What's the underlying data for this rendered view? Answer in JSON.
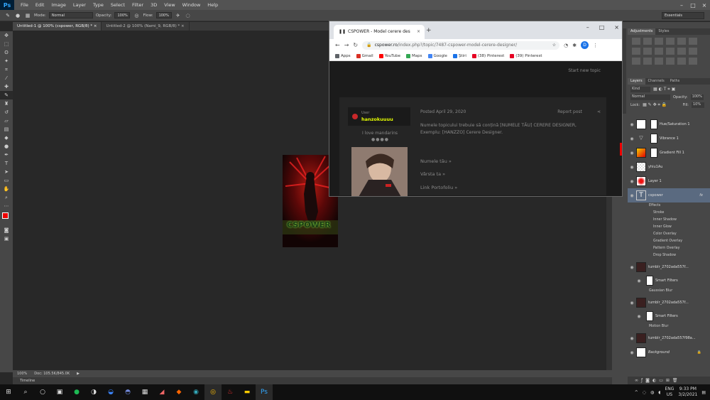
{
  "photoshop": {
    "logo": "Ps",
    "menu": [
      "File",
      "Edit",
      "Image",
      "Layer",
      "Type",
      "Select",
      "Filter",
      "3D",
      "View",
      "Window",
      "Help"
    ],
    "options": {
      "mode_label": "Mode:",
      "mode_value": "Normal",
      "opacity_label": "Opacity:",
      "opacity_value": "100%",
      "flow_label": "Flow:",
      "flow_value": "100%"
    },
    "workspace": "Essentials",
    "tabs": [
      "Untitled-1 @ 100% (cspower, RGB/8) * ×",
      "Untitled-2 @ 100% (Nami_9, RGB/8) * ×"
    ],
    "status": {
      "zoom": "100%",
      "doc": "Doc: 105.5K/845.0K"
    },
    "timeline": "Timeline",
    "artboard_text": "CSPOWER",
    "adjustments_tabs": [
      "Adjustments",
      "Styles"
    ],
    "layers_tabs": [
      "Layers",
      "Channels",
      "Paths"
    ],
    "layers_filter": "Kind",
    "blend_mode": "Normal",
    "opacity_label": "Opacity:",
    "opacity": "100%",
    "lock_label": "Lock:",
    "fill_label": "Fill:",
    "fill": "10%",
    "layers": [
      {
        "name": "Hue/Saturation 1"
      },
      {
        "name": "Vibrance 1"
      },
      {
        "name": "Gradient Fill 1"
      },
      {
        "name": "yhiu1Au"
      },
      {
        "name": "Layer 1"
      },
      {
        "name": "cspower",
        "fx": "fx"
      },
      {
        "name": "tumblr_2702ada557f...",
        "sub": [
          "Smart Filters",
          "Gaussian Blur"
        ]
      },
      {
        "name": "tumblr_2702ada557f...",
        "sub": [
          "Smart Filters",
          "Motion Blur"
        ]
      },
      {
        "name": "tumblr_2702ada557f98a..."
      },
      {
        "name": "Background"
      }
    ],
    "effects": [
      "Effects",
      "Stroke",
      "Inner Shadow",
      "Inner Glow",
      "Color Overlay",
      "Gradient Overlay",
      "Pattern Overlay",
      "Drop Shadow"
    ]
  },
  "browser": {
    "tab_title": "CSPOWER - Model cerere des",
    "url_domain": "cspower.ro",
    "url_path": "/index.php?/topic/7487-cspower-model-cerere-designer/",
    "avatar_letter": "D",
    "bookmarks": [
      {
        "label": "Apps",
        "color": "#5f6368"
      },
      {
        "label": "Gmail",
        "color": "#d93025"
      },
      {
        "label": "YouTube",
        "color": "#ff0000"
      },
      {
        "label": "Maps",
        "color": "#34a853"
      },
      {
        "label": "Google",
        "color": "#4285f4"
      },
      {
        "label": "Știri",
        "color": "#1a73e8"
      },
      {
        "label": "(38) Pinterest",
        "color": "#e60023"
      },
      {
        "label": "(39) Pinterest",
        "color": "#e60023"
      }
    ],
    "start_new_topic": "Start new topic",
    "post": {
      "user_role": "User",
      "username": "hanzokuuuu",
      "motto": "I love mandarins",
      "dots": "●●●●",
      "posted": "Posted April 29, 2020",
      "report": "Report post",
      "body": "Numele topicului trebuie să conțină [NUMELE TĂU] CERERE DESIGNER, Exemplu: [HANZZO] Cerere Designer.",
      "fields": [
        "Numele tău »",
        "Vârsta ta »",
        "Link Portofoliu »"
      ]
    }
  },
  "taskbar": {
    "lang": "ENG",
    "region": "US",
    "time": "9:33 PM",
    "date": "3/2/2021"
  }
}
